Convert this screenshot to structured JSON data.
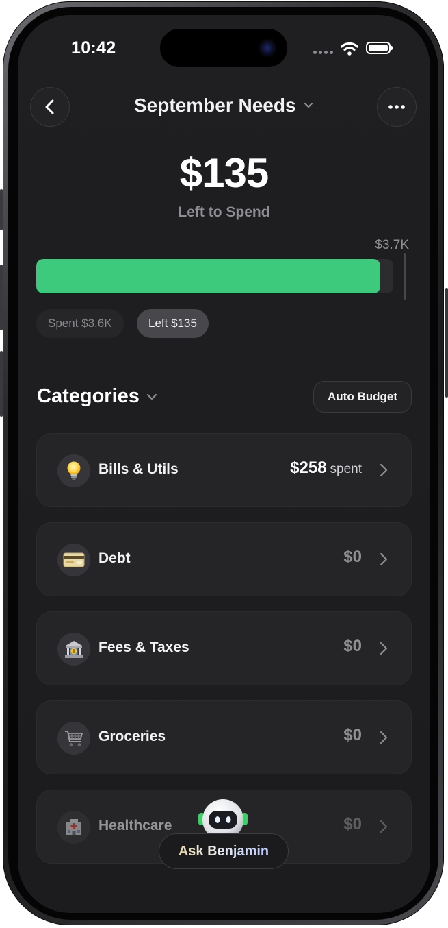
{
  "status_bar": {
    "time": "10:42"
  },
  "header": {
    "title": "September Needs"
  },
  "summary": {
    "amount": "$135",
    "amount_label": "Left to Spend",
    "budget_total": "$3.7K",
    "spent_fraction": 0.963,
    "spent_pill": "Spent $3.6K",
    "left_pill": "Left $135"
  },
  "categories_section": {
    "heading": "Categories",
    "auto_budget_label": "Auto Budget",
    "items": [
      {
        "name": "Bills & Utils",
        "value": "$258",
        "suffix": "spent",
        "icon": "lightbulb-icon"
      },
      {
        "name": "Debt",
        "value": "$0",
        "suffix": "",
        "icon": "credit-card-icon"
      },
      {
        "name": "Fees & Taxes",
        "value": "$0",
        "suffix": "",
        "icon": "bank-icon"
      },
      {
        "name": "Groceries",
        "value": "$0",
        "suffix": "",
        "icon": "shopping-cart-icon"
      },
      {
        "name": "Healthcare",
        "value": "$0",
        "suffix": "",
        "icon": "hospital-icon"
      }
    ]
  },
  "assistant": {
    "label": "Ask Benjamin"
  },
  "colors": {
    "accent_green": "#3dca7c",
    "background": "#1c1c1e",
    "card": "#252527"
  }
}
